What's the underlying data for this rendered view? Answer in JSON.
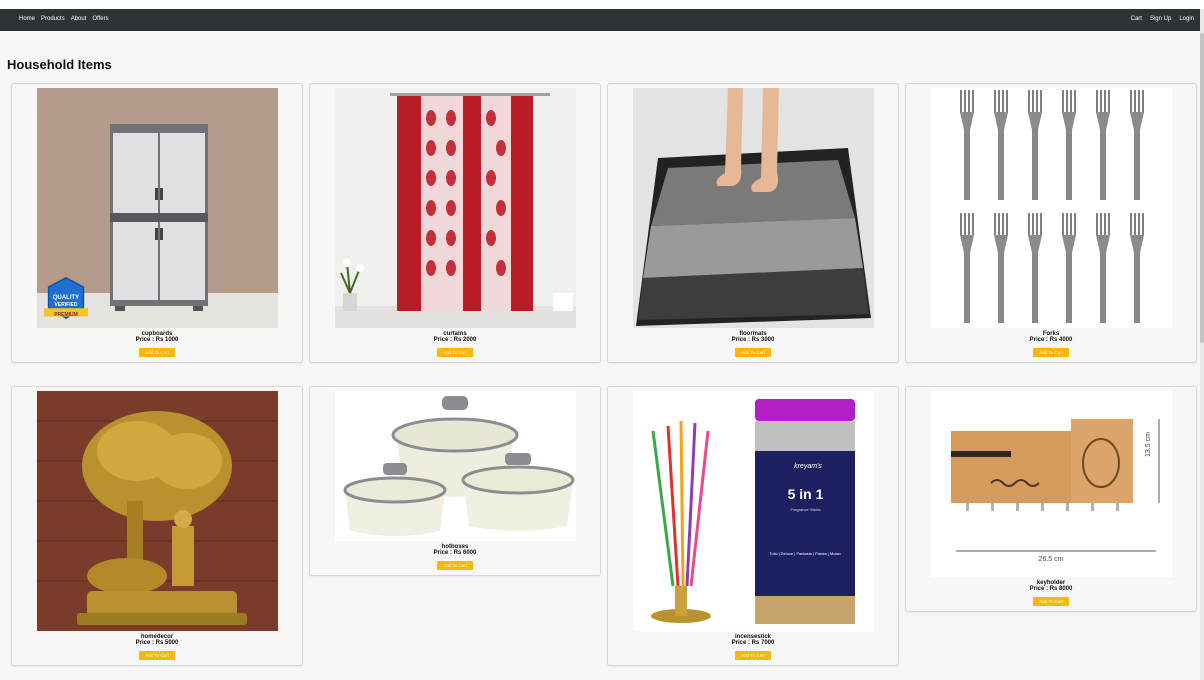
{
  "nav": {
    "left": [
      "Home",
      "Products",
      "About",
      "Offers"
    ],
    "right": [
      "Cart",
      "Sign Up",
      "Login"
    ]
  },
  "heading": "Household Items",
  "price_prefix": "Price : Rs",
  "add_to_cart_label": "Add To Cart",
  "products": [
    {
      "name": "cupboards",
      "price": "Price : Rs 1000",
      "badge": {
        "line1": "QUALITY",
        "line2": "VERIFIED",
        "ribbon": "PREMIUM"
      }
    },
    {
      "name": "curtains",
      "price": "Price : Rs 2000"
    },
    {
      "name": "floormats",
      "price": "Price : Rs 3000"
    },
    {
      "name": "Forks",
      "price": "Price : Rs 4000"
    },
    {
      "name": "homedecor",
      "price": "Price : Rs 5000"
    },
    {
      "name": "hotboxes",
      "price": "Price : Rs 6000"
    },
    {
      "name": "incensestick",
      "price": "Price : Rs 7000",
      "jar": {
        "brand": "kreyam's",
        "title": "5 in 1",
        "subtitle": "Fragrance Sticks",
        "flavors": "Tulsi | Deluxe | Fantasia | Panda | Mulan"
      }
    },
    {
      "name": "keyholder",
      "price": "Price : Rs 8000",
      "dims": {
        "width": "26.5 cm",
        "height": "13.5 cm"
      }
    }
  ],
  "colors": {
    "navbar": "#2e3338",
    "button": "#f9b800",
    "page_bg": "#f7f7f7"
  }
}
